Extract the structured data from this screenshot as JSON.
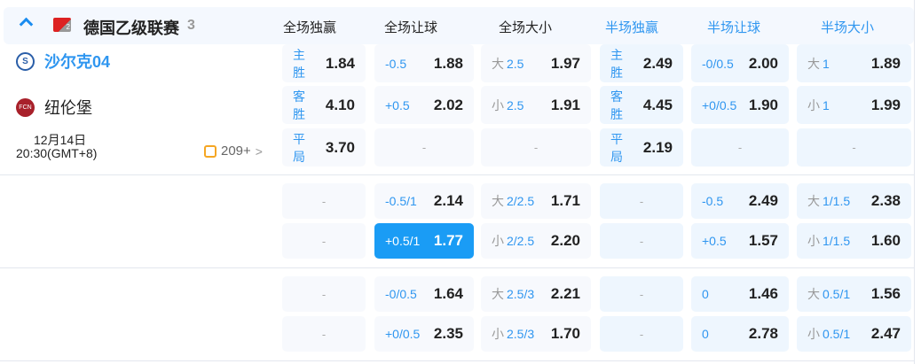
{
  "league": {
    "name": "德国乙级联赛",
    "count": "3",
    "icon": "bundesliga-2-logo"
  },
  "columns": [
    "全场独赢",
    "全场让球",
    "全场大小",
    "半场独赢",
    "半场让球",
    "半场大小"
  ],
  "match": {
    "home": "沙尔克04",
    "away": "纽伦堡",
    "date": "12月14日",
    "time": "20:30(GMT+8)",
    "more": "209+",
    "highlight_color": "#1a9cf5"
  },
  "groups": [
    [
      [
        {
          "l": "主胜",
          "v": "1.84"
        },
        {
          "l": "-0.5",
          "v": "1.88"
        },
        {
          "p": "大",
          "l": "2.5",
          "v": "1.97"
        },
        {
          "l": "主胜",
          "v": "2.49"
        },
        {
          "l": "-0/0.5",
          "v": "2.00"
        },
        {
          "p": "大",
          "l": "1",
          "v": "1.89"
        }
      ],
      [
        {
          "l": "客胜",
          "v": "4.10"
        },
        {
          "l": "+0.5",
          "v": "2.02"
        },
        {
          "p": "小",
          "l": "2.5",
          "v": "1.91"
        },
        {
          "l": "客胜",
          "v": "4.45"
        },
        {
          "l": "+0/0.5",
          "v": "1.90"
        },
        {
          "p": "小",
          "l": "1",
          "v": "1.99"
        }
      ],
      [
        {
          "l": "平局",
          "v": "3.70"
        },
        {
          "e": "-"
        },
        {
          "e": "-"
        },
        {
          "l": "平局",
          "v": "2.19"
        },
        {
          "e": "-"
        },
        {
          "e": "-"
        }
      ]
    ],
    [
      [
        {
          "e": "-"
        },
        {
          "l": "-0.5/1",
          "v": "2.14"
        },
        {
          "p": "大",
          "l": "2/2.5",
          "v": "1.71"
        },
        {
          "e": "-"
        },
        {
          "l": "-0.5",
          "v": "2.49"
        },
        {
          "p": "大",
          "l": "1/1.5",
          "v": "2.38"
        }
      ],
      [
        {
          "e": "-"
        },
        {
          "l": "+0.5/1",
          "v": "1.77",
          "selected": true
        },
        {
          "p": "小",
          "l": "2/2.5",
          "v": "2.20"
        },
        {
          "e": "-"
        },
        {
          "l": "+0.5",
          "v": "1.57"
        },
        {
          "p": "小",
          "l": "1/1.5",
          "v": "1.60"
        }
      ]
    ],
    [
      [
        {
          "e": "-"
        },
        {
          "l": "-0/0.5",
          "v": "1.64"
        },
        {
          "p": "大",
          "l": "2.5/3",
          "v": "2.21"
        },
        {
          "e": "-"
        },
        {
          "l": "0",
          "v": "1.46"
        },
        {
          "p": "大",
          "l": "0.5/1",
          "v": "1.56"
        }
      ],
      [
        {
          "e": "-"
        },
        {
          "l": "+0/0.5",
          "v": "2.35"
        },
        {
          "p": "小",
          "l": "2.5/3",
          "v": "1.70"
        },
        {
          "e": "-"
        },
        {
          "l": "0",
          "v": "2.78"
        },
        {
          "p": "小",
          "l": "0.5/1",
          "v": "2.47"
        }
      ]
    ]
  ]
}
